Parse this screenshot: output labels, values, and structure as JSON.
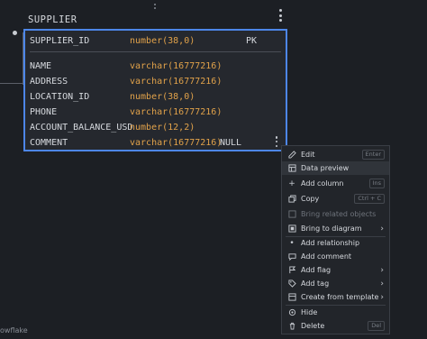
{
  "table": {
    "name": "SUPPLIER",
    "primary_row": {
      "name": "SUPPLIER_ID",
      "type": "number(38,0)",
      "extra": "PK"
    },
    "rows": [
      {
        "name": "NAME",
        "type": "varchar(16777216)",
        "extra": ""
      },
      {
        "name": "ADDRESS",
        "type": "varchar(16777216)",
        "extra": ""
      },
      {
        "name": "LOCATION_ID",
        "type": "number(38,0)",
        "extra": ""
      },
      {
        "name": "PHONE",
        "type": "varchar(16777216)",
        "extra": ""
      },
      {
        "name": "ACCOUNT_BALANCE_USD",
        "type": "number(12,2)",
        "extra": ""
      },
      {
        "name": "COMMENT",
        "type": "varchar(16777216)",
        "extra": "NULL"
      }
    ]
  },
  "context_menu": {
    "items": [
      {
        "icon": "edit-icon",
        "label": "Edit",
        "shortcut": "Enter",
        "disabled": false,
        "submenu": false
      },
      {
        "icon": "data-preview-icon",
        "label": "Data preview",
        "shortcut": "",
        "disabled": false,
        "submenu": false
      },
      {
        "icon": "plus-icon",
        "label": "Add column",
        "shortcut": "Ins",
        "disabled": false,
        "submenu": false
      },
      {
        "icon": "copy-icon",
        "label": "Copy",
        "shortcut": "Ctrl + C",
        "disabled": false,
        "submenu": false
      },
      {
        "icon": "related-objects-icon",
        "label": "Bring related objects",
        "shortcut": "",
        "disabled": true,
        "submenu": false
      },
      {
        "icon": "bring-to-diagram-icon",
        "label": "Bring to diagram",
        "shortcut": "",
        "disabled": false,
        "submenu": true
      },
      {
        "icon": "relationship-icon",
        "label": "Add relationship",
        "shortcut": "",
        "disabled": false,
        "submenu": false
      },
      {
        "icon": "comment-icon",
        "label": "Add comment",
        "shortcut": "",
        "disabled": false,
        "submenu": false
      },
      {
        "icon": "flag-icon",
        "label": "Add flag",
        "shortcut": "",
        "disabled": false,
        "submenu": true
      },
      {
        "icon": "tag-icon",
        "label": "Add tag",
        "shortcut": "",
        "disabled": false,
        "submenu": true
      },
      {
        "icon": "template-icon",
        "label": "Create from template",
        "shortcut": "",
        "disabled": false,
        "submenu": true
      },
      {
        "icon": "hide-icon",
        "label": "Hide",
        "shortcut": "",
        "disabled": false,
        "submenu": false
      },
      {
        "icon": "trash-icon",
        "label": "Delete",
        "shortcut": "Del",
        "disabled": false,
        "submenu": false
      }
    ]
  },
  "footer": {
    "text": "owflake"
  }
}
